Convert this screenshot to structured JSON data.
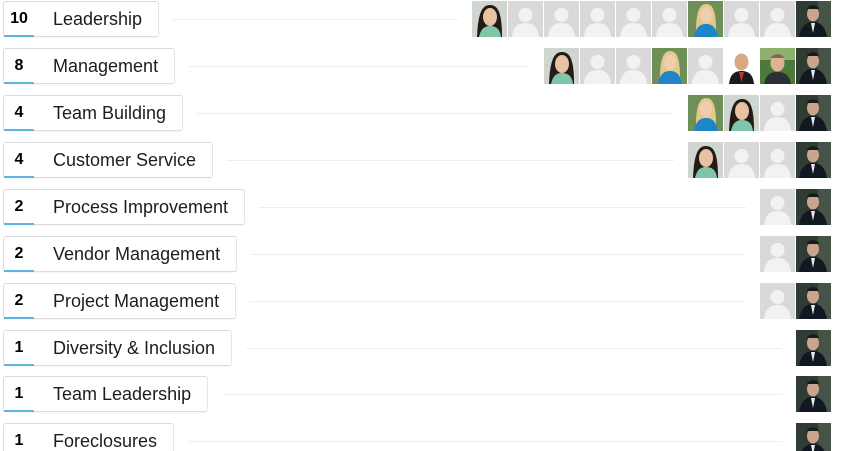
{
  "skills": [
    {
      "count": "10",
      "name": "Leadership",
      "endorsers": [
        "woman-dark-hair",
        "placeholder",
        "placeholder",
        "placeholder",
        "placeholder",
        "placeholder",
        "woman-blonde",
        "placeholder",
        "placeholder",
        "man-dark-suit"
      ]
    },
    {
      "count": "8",
      "name": "Management",
      "endorsers": [
        "woman-dark-hair",
        "placeholder",
        "placeholder",
        "woman-blonde",
        "placeholder",
        "man-bald",
        "man-outdoor",
        "man-dark-suit"
      ]
    },
    {
      "count": "4",
      "name": "Team Building",
      "endorsers": [
        "woman-blonde",
        "woman-dark-hair",
        "placeholder",
        "man-dark-suit"
      ]
    },
    {
      "count": "4",
      "name": "Customer Service",
      "endorsers": [
        "woman-dark-hair",
        "placeholder",
        "placeholder",
        "man-dark-suit"
      ]
    },
    {
      "count": "2",
      "name": "Process Improvement",
      "endorsers": [
        "placeholder",
        "man-dark-suit"
      ]
    },
    {
      "count": "2",
      "name": "Vendor Management",
      "endorsers": [
        "placeholder",
        "man-dark-suit"
      ]
    },
    {
      "count": "2",
      "name": "Project Management",
      "endorsers": [
        "placeholder",
        "man-dark-suit"
      ]
    },
    {
      "count": "1",
      "name": "Diversity & Inclusion",
      "endorsers": [
        "man-dark-suit"
      ]
    },
    {
      "count": "1",
      "name": "Team Leadership",
      "endorsers": [
        "man-dark-suit"
      ]
    },
    {
      "count": "1",
      "name": "Foreclosures",
      "endorsers": [
        "man-dark-suit"
      ]
    }
  ],
  "colors": {
    "accent": "#5eb5e0",
    "placeholder_bg": "#d9d9d9",
    "placeholder_fg": "#f2f2f2"
  }
}
